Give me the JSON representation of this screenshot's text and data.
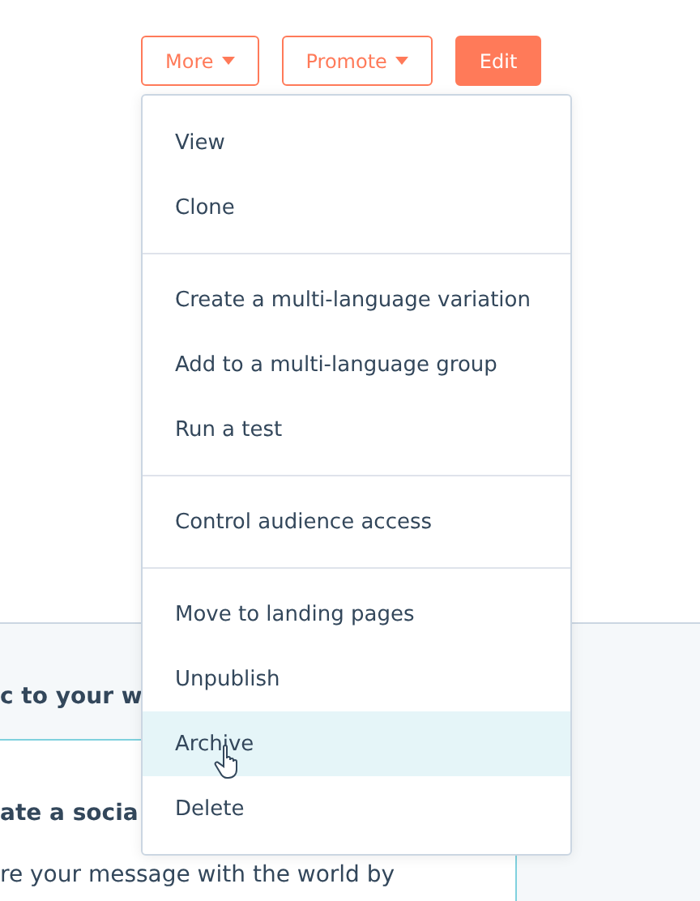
{
  "buttons": [
    {
      "label": "More",
      "kind": "dropdown"
    },
    {
      "label": "Promote",
      "kind": "dropdown"
    },
    {
      "label": "Edit",
      "kind": "primary"
    }
  ],
  "menu": {
    "groups": [
      {
        "items": [
          {
            "label": "View",
            "selected": false
          },
          {
            "label": "Clone",
            "selected": false
          }
        ]
      },
      {
        "items": [
          {
            "label": "Create a multi-language variation",
            "selected": false
          },
          {
            "label": "Add to a multi-language group",
            "selected": false
          },
          {
            "label": "Run a test",
            "selected": false
          }
        ]
      },
      {
        "items": [
          {
            "label": "Control audience access",
            "selected": false
          }
        ]
      },
      {
        "items": [
          {
            "label": "Move to landing pages",
            "selected": false
          },
          {
            "label": "Unpublish",
            "selected": false
          },
          {
            "label": "Archive",
            "selected": true
          },
          {
            "label": "Delete",
            "selected": false
          }
        ]
      }
    ]
  },
  "background": {
    "section_heading": "c to your w",
    "card_heading": "ate a socia",
    "card_text": "re your message with the world by"
  }
}
